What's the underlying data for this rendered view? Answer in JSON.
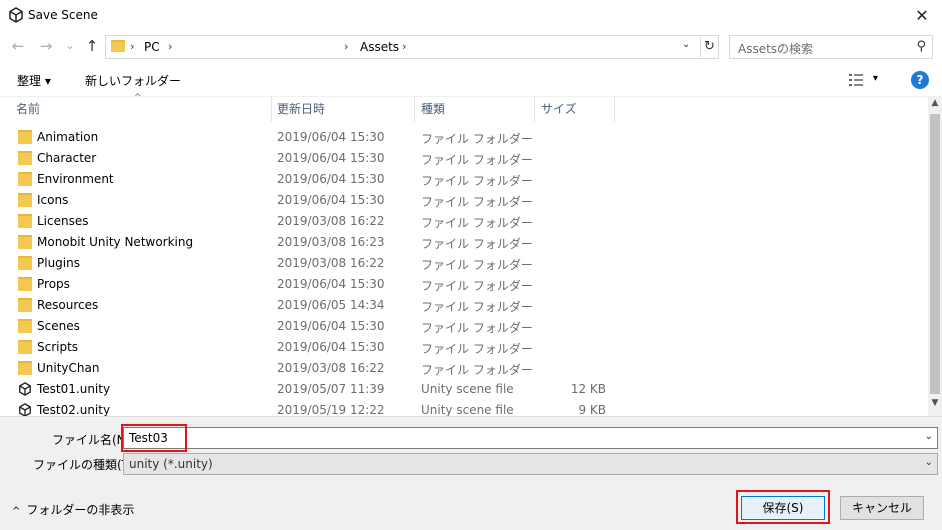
{
  "window": {
    "title": "Save Scene",
    "close_glyph": "✕"
  },
  "nav": {
    "back_glyph": "←",
    "forward_glyph": "→",
    "recent_glyph": "⌄",
    "up_glyph": "↑",
    "address": [
      {
        "chev": "›",
        "label": "PC"
      },
      {
        "chev": "›",
        "label": "Assets"
      }
    ],
    "dropdown_glyph": "⌄",
    "refresh_glyph": "↻",
    "search_placeholder": "Assetsの検索",
    "search_glyph": "⚲"
  },
  "toolbar": {
    "organize_label": "整理 ▾",
    "new_folder_label": "新しいフォルダー",
    "view_dropdown_glyph": "▾",
    "help_label": "?"
  },
  "columns": {
    "sort_glyph": "^",
    "name": "名前",
    "date": "更新日時",
    "type": "種類",
    "size": "サイズ"
  },
  "files": [
    {
      "icon": "folder-icon",
      "name": "Animation",
      "date": "2019/06/04 15:30",
      "type": "ファイル フォルダー",
      "size": ""
    },
    {
      "icon": "folder-icon",
      "name": "Character",
      "date": "2019/06/04 15:30",
      "type": "ファイル フォルダー",
      "size": ""
    },
    {
      "icon": "folder-icon",
      "name": "Environment",
      "date": "2019/06/04 15:30",
      "type": "ファイル フォルダー",
      "size": ""
    },
    {
      "icon": "folder-icon",
      "name": "Icons",
      "date": "2019/06/04 15:30",
      "type": "ファイル フォルダー",
      "size": ""
    },
    {
      "icon": "folder-icon",
      "name": "Licenses",
      "date": "2019/03/08 16:22",
      "type": "ファイル フォルダー",
      "size": ""
    },
    {
      "icon": "folder-icon",
      "name": "Monobit Unity Networking",
      "date": "2019/03/08 16:23",
      "type": "ファイル フォルダー",
      "size": ""
    },
    {
      "icon": "folder-icon",
      "name": "Plugins",
      "date": "2019/03/08 16:22",
      "type": "ファイル フォルダー",
      "size": ""
    },
    {
      "icon": "folder-icon",
      "name": "Props",
      "date": "2019/06/04 15:30",
      "type": "ファイル フォルダー",
      "size": ""
    },
    {
      "icon": "folder-icon",
      "name": "Resources",
      "date": "2019/06/05 14:34",
      "type": "ファイル フォルダー",
      "size": ""
    },
    {
      "icon": "folder-icon",
      "name": "Scenes",
      "date": "2019/06/04 15:30",
      "type": "ファイル フォルダー",
      "size": ""
    },
    {
      "icon": "folder-icon",
      "name": "Scripts",
      "date": "2019/06/04 15:30",
      "type": "ファイル フォルダー",
      "size": ""
    },
    {
      "icon": "folder-icon",
      "name": "UnityChan",
      "date": "2019/03/08 16:22",
      "type": "ファイル フォルダー",
      "size": ""
    },
    {
      "icon": "unity-scene-icon",
      "name": "Test01.unity",
      "date": "2019/05/07 11:39",
      "type": "Unity scene file",
      "size": "12 KB"
    },
    {
      "icon": "unity-scene-icon",
      "name": "Test02.unity",
      "date": "2019/05/19 12:22",
      "type": "Unity scene file",
      "size": "9 KB"
    }
  ],
  "scrollbar": {
    "up_glyph": "▲",
    "down_glyph": "▼"
  },
  "form": {
    "filename_label": "ファイル名(N):",
    "filename_value": "Test03",
    "filetype_label": "ファイルの種類(T):",
    "filetype_value": "unity (*.unity)",
    "dropdown_glyph": "⌄",
    "hide_folders_glyph": "^",
    "hide_folders_label": "フォルダーの非表示",
    "save_label": "保存(S)",
    "cancel_label": "キャンセル"
  },
  "colors": {
    "highlight": "#e0141e",
    "accent": "#0078d7",
    "folder": "#f4c951"
  }
}
